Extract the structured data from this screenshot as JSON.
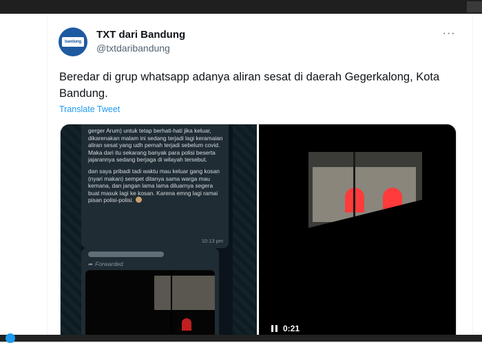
{
  "tweet": {
    "author": {
      "display_name": "TXT dari Bandung",
      "handle": "@txtdaribandung",
      "avatar_text": "bandung"
    },
    "text": "Beredar di grup whatsapp adanya aliran sesat di daerah Gegerkalong, Kota Bandung.",
    "translate_label": "Translate Tweet",
    "more_label": "···"
  },
  "media": {
    "chat": {
      "paragraph_1": "gerger Arum) untuk tetap berhati-hati jika keluar, dikarenakan malam ini sedang terjadi lagi keramaian aliran sesat yang udh pernah terjadi sebelum covid. Maka dari itu sekarang banyak para polisi beserta jajarannya sedang berjaga di wilayah tersebut.",
      "paragraph_2": "dan saya pribadi tadi waktu mau keluar gang kosan (nyari makan) sempet ditanya sama warga mau kemana, dan jangan lama lama diluarnya segera buat masuk lagi ke kosan. Karena emng lagi ramai pisan polisi-polisi.",
      "timestamp": "10:13 pm",
      "forwarded_label": "Forwarded"
    },
    "video": {
      "elapsed": "0:21",
      "state": "playing"
    }
  },
  "colors": {
    "link": "#1d9bf0",
    "whatsapp_bubble": "#202c33"
  }
}
